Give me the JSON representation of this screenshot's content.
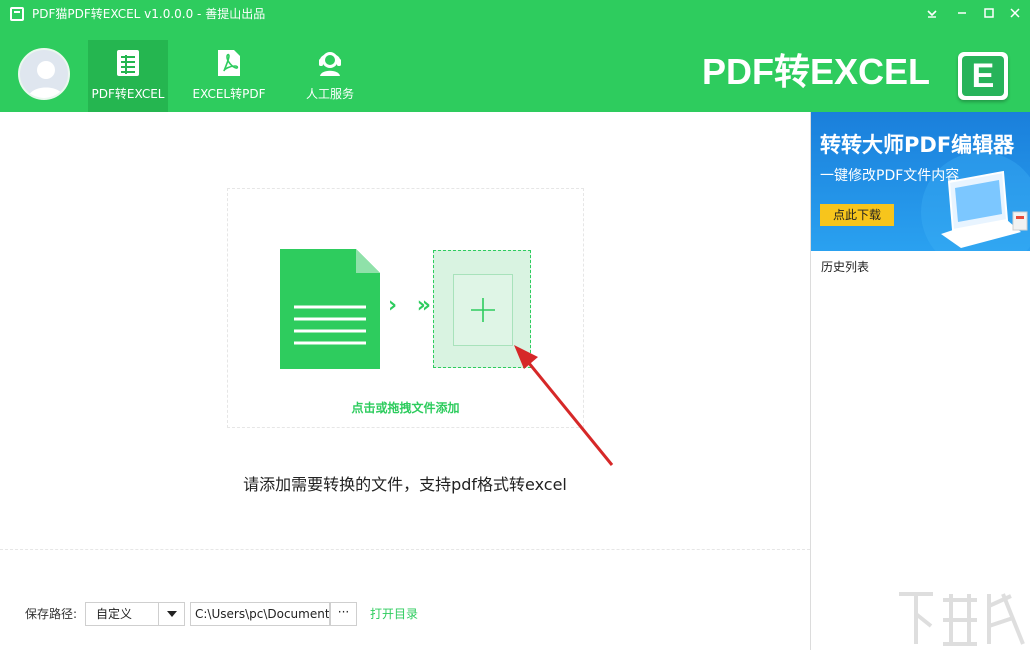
{
  "window": {
    "title": "PDF猫PDF转EXCEL v1.0.0.0 - 善提山出品",
    "controls": [
      "dropdown-icon",
      "minimize-icon",
      "maximize-icon",
      "close-icon"
    ]
  },
  "nav": {
    "tabs": [
      {
        "label": "PDF转EXCEL",
        "icon": "spreadsheet-icon",
        "active": true
      },
      {
        "label": "EXCEL转PDF",
        "icon": "pdf-icon",
        "active": false
      },
      {
        "label": "人工服务",
        "icon": "customer-service-icon",
        "active": false
      }
    ]
  },
  "brand": {
    "text": "PDF转EXCEL",
    "logo_letter": "E"
  },
  "drop_zone": {
    "hint": "点击或拖拽文件添加",
    "chevrons": "› »"
  },
  "instruction": "请添加需要转换的文件，支持pdf格式转excel",
  "footer": {
    "save_label": "保存路径:",
    "save_mode": "自定义",
    "path_value": "C:\\Users\\pc\\Documents",
    "browse_label": "···",
    "open_dir_label": "打开目录"
  },
  "ad_banner": {
    "title": "转转大师PDF编辑器",
    "subtitle": "一键修改PDF文件内容",
    "button": "点此下载"
  },
  "history": {
    "label": "历史列表"
  },
  "colors": {
    "brand_green": "#2ecc5e",
    "active_tab": "#25b650",
    "banner_blue": "#1d87e0",
    "banner_button": "#f7c51c",
    "annotation_red": "#d62828"
  }
}
